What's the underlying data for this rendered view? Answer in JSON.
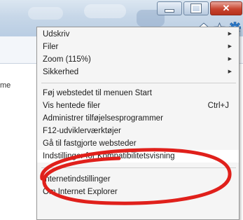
{
  "menu": {
    "items_top": [
      {
        "label": "Udskriv",
        "has_submenu": true
      },
      {
        "label": "Filer",
        "has_submenu": true
      },
      {
        "label": "Zoom (115%)",
        "has_submenu": true
      },
      {
        "label": "Sikkerhed",
        "has_submenu": true
      }
    ],
    "items_mid": [
      {
        "label": "Føj webstedet til menuen Start",
        "shortcut": ""
      },
      {
        "label": "Vis hentede filer",
        "shortcut": "Ctrl+J"
      },
      {
        "label": "Administrer tilføjelsesprogrammer",
        "shortcut": ""
      },
      {
        "label": "F12-udviklerværktøjer",
        "shortcut": ""
      },
      {
        "label": "Gå til fastgjorte websteder",
        "shortcut": ""
      },
      {
        "label": "Indstillinger for Kompatibilitetsvisning",
        "shortcut": ""
      }
    ],
    "items_bottom": [
      {
        "label": "Internetindstillinger"
      },
      {
        "label": "Om Internet Explorer"
      }
    ]
  },
  "page": {
    "partial_text": "me"
  },
  "toolbar": {
    "icons": [
      "home-icon",
      "favorites-star-icon",
      "tools-gear-icon"
    ]
  },
  "window_buttons": [
    "minimize",
    "maximize",
    "close"
  ],
  "annotation": {
    "color": "#e0201b",
    "highlighted_item": "Indstillinger for Kompatibilitetsvisning"
  }
}
